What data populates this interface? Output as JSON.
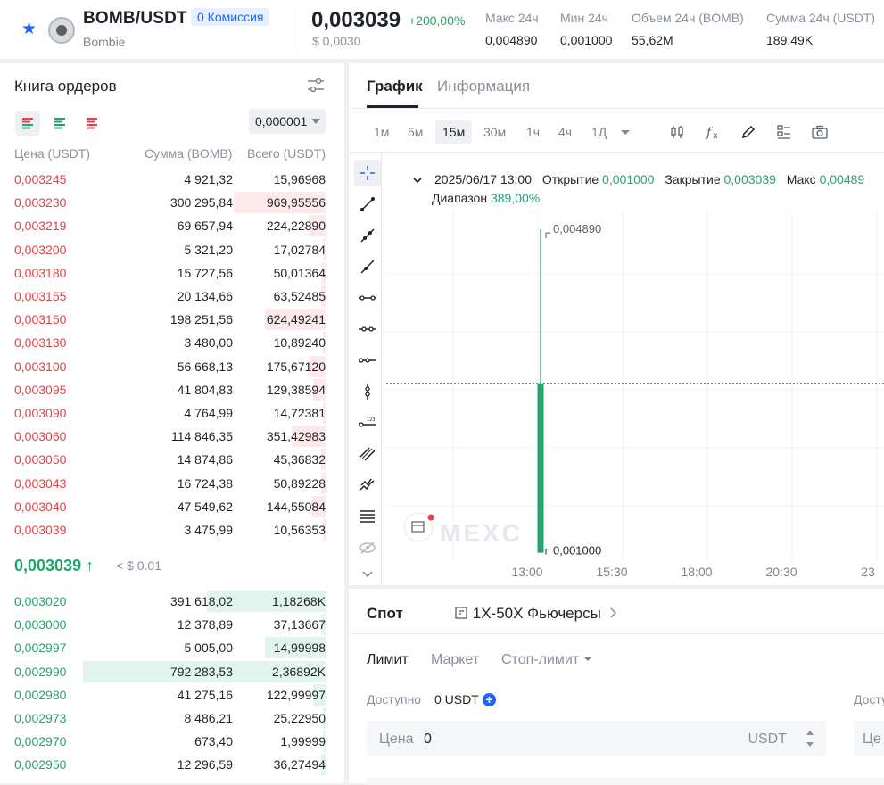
{
  "header": {
    "pair": "BOMB/USDT",
    "commission": "0 Комиссия",
    "name": "Bombie",
    "price": "0,003039",
    "change": "+200,00%",
    "price_usd": "$ 0,0030",
    "stats": [
      {
        "label": "Макс 24ч",
        "value": "0,004890"
      },
      {
        "label": "Мин 24ч",
        "value": "0,001000"
      },
      {
        "label": "Объем 24ч (BOMB)",
        "value": "55,62M"
      },
      {
        "label": "Сумма 24ч (USDT)",
        "value": "189,49K"
      }
    ]
  },
  "orderbook": {
    "title": "Книга ордеров",
    "precision": "0,000001",
    "headers": {
      "price": "Цена (USDT)",
      "amount": "Сумма (BOMB)",
      "total": "Всего (USDT)"
    },
    "asks": [
      {
        "price": "0,003245",
        "amount": "4 921,32",
        "total": "15,96968",
        "depth": 0.0
      },
      {
        "price": "0,003230",
        "amount": "300 295,84",
        "total": "969,95556",
        "depth": 0.38
      },
      {
        "price": "0,003219",
        "amount": "69 657,94",
        "total": "224,22890",
        "depth": 0.07
      },
      {
        "price": "0,003200",
        "amount": "5 321,20",
        "total": "17,02784",
        "depth": 0.01
      },
      {
        "price": "0,003180",
        "amount": "15 727,56",
        "total": "50,01364",
        "depth": 0.02
      },
      {
        "price": "0,003155",
        "amount": "20 134,66",
        "total": "63,52485",
        "depth": 0.02
      },
      {
        "price": "0,003150",
        "amount": "198 251,56",
        "total": "624,49241",
        "depth": 0.25
      },
      {
        "price": "0,003130",
        "amount": "3 480,00",
        "total": "10,89240",
        "depth": 0.01
      },
      {
        "price": "0,003100",
        "amount": "56 668,13",
        "total": "175,67120",
        "depth": 0.07
      },
      {
        "price": "0,003095",
        "amount": "41 804,83",
        "total": "129,38594",
        "depth": 0.05
      },
      {
        "price": "0,003090",
        "amount": "4 764,99",
        "total": "14,72381",
        "depth": 0.01
      },
      {
        "price": "0,003060",
        "amount": "114 846,35",
        "total": "351,42983",
        "depth": 0.14
      },
      {
        "price": "0,003050",
        "amount": "14 874,86",
        "total": "45,36832",
        "depth": 0.02
      },
      {
        "price": "0,003043",
        "amount": "16 724,38",
        "total": "50,89228",
        "depth": 0.02
      },
      {
        "price": "0,003040",
        "amount": "47 549,62",
        "total": "144,55084",
        "depth": 0.06
      },
      {
        "price": "0,003039",
        "amount": "3 475,99",
        "total": "10,56353",
        "depth": 0.01
      }
    ],
    "mid": {
      "price": "0,003039",
      "arrow": "↑",
      "usd": "< $ 0.01"
    },
    "bids": [
      {
        "price": "0,003020",
        "amount": "391 618,02",
        "total": "1,18268K",
        "depth": 0.49
      },
      {
        "price": "0,003000",
        "amount": "12 378,89",
        "total": "37,13667",
        "depth": 0.02
      },
      {
        "price": "0,002997",
        "amount": "5 005,00",
        "total": "14,99998",
        "depth": 0.25
      },
      {
        "price": "0,002990",
        "amount": "792 283,53",
        "total": "2,36892K",
        "depth": 1.0
      },
      {
        "price": "0,002980",
        "amount": "41 275,16",
        "total": "122,99997",
        "depth": 0.05
      },
      {
        "price": "0,002973",
        "amount": "8 486,21",
        "total": "25,22950",
        "depth": 0.01
      },
      {
        "price": "0,002970",
        "amount": "673,40",
        "total": "1,99999",
        "depth": 0.01
      },
      {
        "price": "0,002950",
        "amount": "12 296,59",
        "total": "36,27494",
        "depth": 0.02
      }
    ]
  },
  "chart_panel": {
    "tabs": [
      "График",
      "Информация"
    ],
    "timeframes": [
      "1м",
      "5м",
      "15м",
      "30м",
      "1ч",
      "4ч",
      "1Д"
    ],
    "active_timeframe": "15м",
    "ohlc": {
      "date": "2025/06/17 13:00",
      "open_label": "Открытие",
      "open": "0,001000",
      "close_label": "Закрытие",
      "close": "0,003039",
      "high_label": "Макс",
      "high": "0,00489",
      "range_label": "Диапазон",
      "range": "389,00%"
    },
    "watermark": "MEXC",
    "high_marker": "0,004890",
    "low_marker": "0,001000"
  },
  "chart_data": {
    "type": "candlestick",
    "x": [
      "13:00"
    ],
    "x_ticks": [
      "13:00",
      "15:30",
      "18:00",
      "20:30",
      "23"
    ],
    "candles": [
      {
        "time": "13:00",
        "open": 0.001,
        "high": 0.00489,
        "low": 0.001,
        "close": 0.003039
      }
    ],
    "last_price_line": 0.003039,
    "colors": {
      "up": "#24a36b"
    }
  },
  "trade": {
    "spot": "Спот",
    "futures": "1X-50X Фьючерсы",
    "order_tabs": [
      "Лимит",
      "Маркет",
      "Стоп-лимит"
    ],
    "available_label": "Доступно",
    "available_value": "0 USDT",
    "available_label_right": "Досту",
    "price_placeholder": "Цена",
    "price_value": "0",
    "price_unit": "USDT",
    "price_placeholder_right": "Це"
  }
}
